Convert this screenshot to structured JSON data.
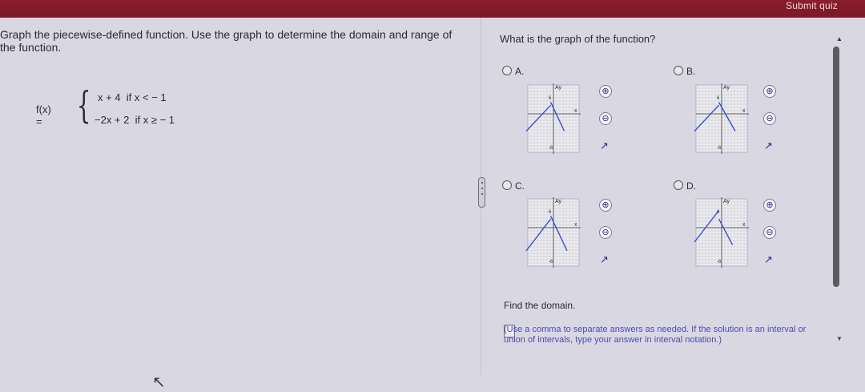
{
  "header": {
    "submit_label": "Submit quiz"
  },
  "left": {
    "question": "Graph the piecewise-defined function. Use the graph to determine the domain and range of the function.",
    "function_label": "f(x) =",
    "brace": "{",
    "piece1_expr": "x + 4",
    "piece1_cond": "if x < − 1",
    "piece2_expr": "−2x + 2",
    "piece2_cond": "if x ≥ − 1"
  },
  "right": {
    "question": "What is the graph of the function?",
    "options": [
      {
        "label": "A."
      },
      {
        "label": "B."
      },
      {
        "label": "C."
      },
      {
        "label": "D."
      }
    ],
    "graph_text": {
      "y_label": "Ay",
      "x_label": "x",
      "tick_pos": "6",
      "tick_neg": "-6"
    },
    "find_label": "Find the domain.",
    "hint": "(Use a comma to separate answers as needed. If the solution is an interval or union of intervals, type your answer in interval notation.)"
  },
  "icons": {
    "zoom_in": "zoom-in-icon",
    "zoom_out": "zoom-out-icon",
    "popout": "external-link-icon",
    "cursor": "mouse-cursor-icon",
    "scroll_up": "scroll-up-icon",
    "scroll_down": "scroll-down-icon"
  },
  "colors": {
    "accent_bar": "#7f1c29",
    "line_color": "#3a4fd0",
    "link_blue": "#4c4cb0"
  }
}
